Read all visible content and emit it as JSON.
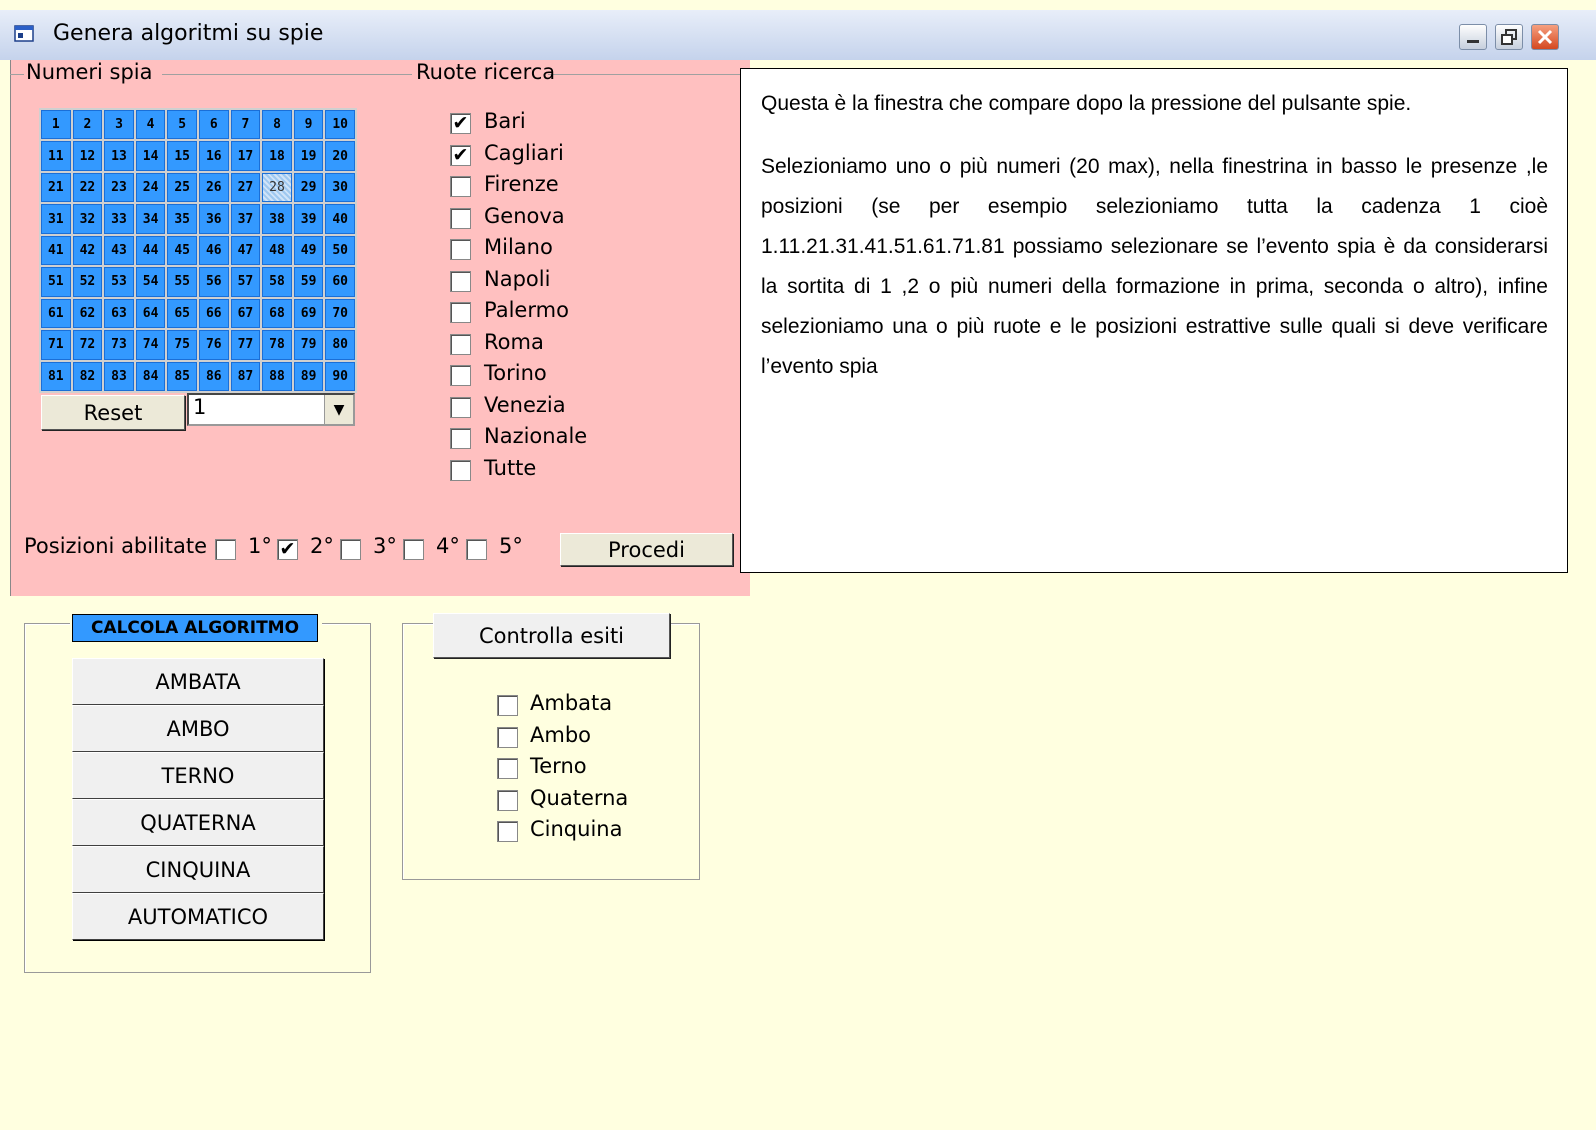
{
  "window": {
    "title": "Genera algoritmi su spie"
  },
  "spia": {
    "label": "Numeri spia",
    "numbers": [
      "1",
      "2",
      "3",
      "4",
      "5",
      "6",
      "7",
      "8",
      "9",
      "10",
      "11",
      "12",
      "13",
      "14",
      "15",
      "16",
      "17",
      "18",
      "19",
      "20",
      "21",
      "22",
      "23",
      "24",
      "25",
      "26",
      "27",
      "28",
      "29",
      "30",
      "31",
      "32",
      "33",
      "34",
      "35",
      "36",
      "37",
      "38",
      "39",
      "40",
      "41",
      "42",
      "43",
      "44",
      "45",
      "46",
      "47",
      "48",
      "49",
      "50",
      "51",
      "52",
      "53",
      "54",
      "55",
      "56",
      "57",
      "58",
      "59",
      "60",
      "61",
      "62",
      "63",
      "64",
      "65",
      "66",
      "67",
      "68",
      "69",
      "70",
      "71",
      "72",
      "73",
      "74",
      "75",
      "76",
      "77",
      "78",
      "79",
      "80",
      "81",
      "82",
      "83",
      "84",
      "85",
      "86",
      "87",
      "88",
      "89",
      "90"
    ],
    "selected": "28",
    "reset_label": "Reset",
    "combo_value": "1"
  },
  "ruote": {
    "label": "Ruote ricerca",
    "items": [
      {
        "label": "Bari",
        "checked": true
      },
      {
        "label": "Cagliari",
        "checked": true
      },
      {
        "label": "Firenze",
        "checked": false
      },
      {
        "label": "Genova",
        "checked": false
      },
      {
        "label": "Milano",
        "checked": false
      },
      {
        "label": "Napoli",
        "checked": false
      },
      {
        "label": "Palermo",
        "checked": false
      },
      {
        "label": "Roma",
        "checked": false
      },
      {
        "label": "Torino",
        "checked": false
      },
      {
        "label": "Venezia",
        "checked": false
      },
      {
        "label": "Nazionale",
        "checked": false
      },
      {
        "label": "Tutte",
        "checked": false
      }
    ]
  },
  "posizioni": {
    "label": "Posizioni abilitate",
    "items": [
      {
        "label": "1°",
        "checked": false
      },
      {
        "label": "2°",
        "checked": true
      },
      {
        "label": "3°",
        "checked": false
      },
      {
        "label": "4°",
        "checked": false
      },
      {
        "label": "5°",
        "checked": false
      }
    ],
    "procedi_label": "Procedi"
  },
  "note": {
    "p1": "Questa è la finestra che compare dopo la pressione del pulsante spie.",
    "p2": "Selezioniamo uno o più numeri (20 max), nella finestrina in basso le presenze ,le posizioni (se per esempio selezioniamo tutta la cadenza 1 cioè 1.11.21.31.41.51.61.71.81 possiamo selezionare se l’evento spia è da considerarsi la sortita  di 1 ,2 o più numeri della formazione in prima, seconda o altro), infine selezioniamo una o più ruote  e le posizioni estrattive sulle quali si deve verificare l’evento spia"
  },
  "calcola": {
    "header": "CALCOLA ALGORITMO",
    "buttons": [
      "AMBATA",
      "AMBO",
      "TERNO",
      "QUATERNA",
      "CINQUINA",
      "AUTOMATICO"
    ]
  },
  "esiti": {
    "button_label": "Controlla esiti",
    "items": [
      {
        "label": "Ambata",
        "checked": false
      },
      {
        "label": "Ambo",
        "checked": false
      },
      {
        "label": "Terno",
        "checked": false
      },
      {
        "label": "Quaterna",
        "checked": false
      },
      {
        "label": "Cinquina",
        "checked": false
      }
    ]
  },
  "colors": {
    "top_panel": "#ffc0c0",
    "background": "#ffffe0",
    "grid_cell": "#3399ff",
    "title_bar": "#c5d3ec"
  }
}
